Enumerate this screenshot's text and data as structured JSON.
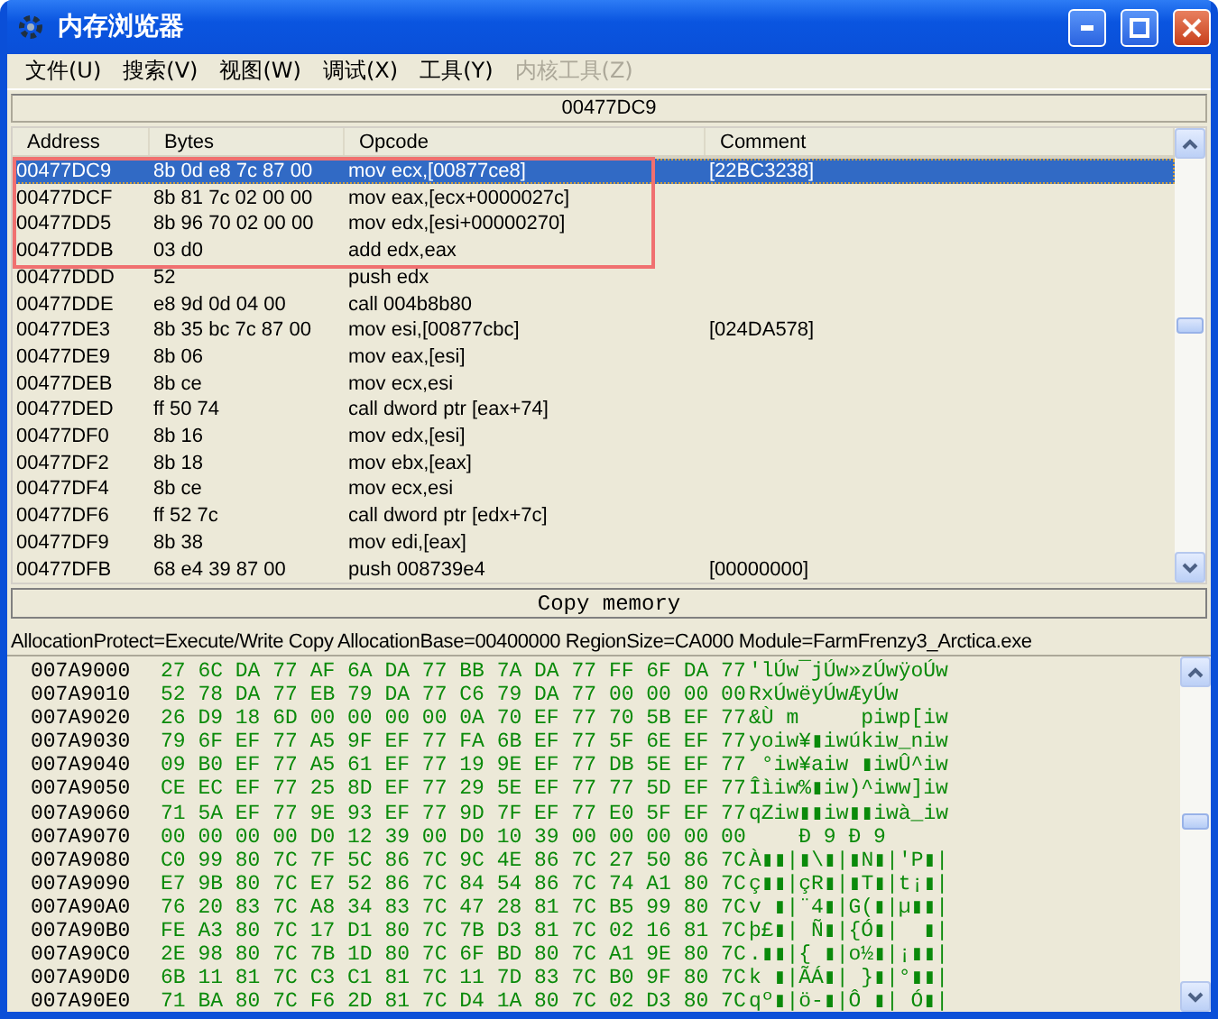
{
  "window": {
    "title": "内存浏览器"
  },
  "menu": [
    {
      "label": "文件(U)",
      "disabled": false
    },
    {
      "label": "搜索(V)",
      "disabled": false
    },
    {
      "label": "视图(W)",
      "disabled": false
    },
    {
      "label": "调试(X)",
      "disabled": false
    },
    {
      "label": "工具(Y)",
      "disabled": false
    },
    {
      "label": "内核工具(Z)",
      "disabled": true
    }
  ],
  "address_bar": "00477DC9",
  "disassembly": {
    "columns": [
      "Address",
      "Bytes",
      "Opcode",
      "Comment"
    ],
    "rows": [
      {
        "address": "00477DC9",
        "bytes": "8b 0d e8 7c 87 00",
        "opcode": "mov ecx,[00877ce8]",
        "comment": "[22BC3238]",
        "selected": true,
        "outlined": true
      },
      {
        "address": "00477DCF",
        "bytes": "8b 81 7c 02 00 00",
        "opcode": "mov eax,[ecx+0000027c]",
        "selected": false,
        "outlined": true
      },
      {
        "address": "00477DD5",
        "bytes": "8b 96 70 02 00 00",
        "opcode": "mov edx,[esi+00000270]",
        "selected": false,
        "outlined": true
      },
      {
        "address": "00477DDB",
        "bytes": "03 d0",
        "opcode": "add edx,eax",
        "selected": false,
        "outlined": true
      },
      {
        "address": "00477DDD",
        "bytes": "52",
        "opcode": "push edx",
        "selected": false,
        "outlined": false
      },
      {
        "address": "00477DDE",
        "bytes": "e8 9d 0d 04 00",
        "opcode": "call 004b8b80",
        "selected": false,
        "outlined": false
      },
      {
        "address": "00477DE3",
        "bytes": "8b 35 bc 7c 87 00",
        "opcode": "mov esi,[00877cbc]",
        "comment": "[024DA578]",
        "selected": false,
        "outlined": false
      },
      {
        "address": "00477DE9",
        "bytes": "8b 06",
        "opcode": "mov eax,[esi]",
        "selected": false,
        "outlined": false
      },
      {
        "address": "00477DEB",
        "bytes": "8b ce",
        "opcode": "mov ecx,esi",
        "selected": false,
        "outlined": false
      },
      {
        "address": "00477DED",
        "bytes": "ff 50 74",
        "opcode": "call dword ptr [eax+74]",
        "selected": false,
        "outlined": false
      },
      {
        "address": "00477DF0",
        "bytes": "8b 16",
        "opcode": "mov edx,[esi]",
        "selected": false,
        "outlined": false
      },
      {
        "address": "00477DF2",
        "bytes": "8b 18",
        "opcode": "mov ebx,[eax]",
        "selected": false,
        "outlined": false
      },
      {
        "address": "00477DF4",
        "bytes": "8b ce",
        "opcode": "mov ecx,esi",
        "selected": false,
        "outlined": false
      },
      {
        "address": "00477DF6",
        "bytes": "ff 52 7c",
        "opcode": "call dword ptr [edx+7c]",
        "selected": false,
        "outlined": false
      },
      {
        "address": "00477DF9",
        "bytes": "8b 38",
        "opcode": "mov edi,[eax]",
        "selected": false,
        "outlined": false
      },
      {
        "address": "00477DFB",
        "bytes": "68 e4 39 87 00",
        "opcode": "push 008739e4",
        "comment": "[00000000]",
        "selected": false,
        "outlined": false
      }
    ]
  },
  "copy_button": "Copy memory",
  "region_info": "AllocationProtect=Execute/Write Copy  AllocationBase=00400000 RegionSize=CA000 Module=FarmFrenzy3_Arctica.exe",
  "hex_rows": [
    {
      "address": "007A9000",
      "hex": "27 6C DA 77 AF 6A DA 77 BB 7A DA 77 FF 6F DA 77",
      "ascii": "'lÚw¯jÚw»zÚwÿoÚw"
    },
    {
      "address": "007A9010",
      "hex": "52 78 DA 77 EB 79 DA 77 C6 79 DA 77 00 00 00 00",
      "ascii": "RxÚwëyÚwÆyÚw"
    },
    {
      "address": "007A9020",
      "hex": "26 D9 18 6D 00 00 00 00 0A 70 EF 77 70 5B EF 77",
      "ascii": "&Ù m     piwp[iw"
    },
    {
      "address": "007A9030",
      "hex": "79 6F EF 77 A5 9F EF 77 FA 6B EF 77 5F 6E EF 77",
      "ascii": "yoiw¥▮iwúkiw_niw"
    },
    {
      "address": "007A9040",
      "hex": "09 B0 EF 77 A5 61 EF 77 19 9E EF 77 DB 5E EF 77",
      "ascii": " °iw¥aiw ▮iwÛ^iw"
    },
    {
      "address": "007A9050",
      "hex": "CE EC EF 77 25 8D EF 77 29 5E EF 77 77 5D EF 77",
      "ascii": "Îìiw%▮iw)^iww]iw"
    },
    {
      "address": "007A9060",
      "hex": "71 5A EF 77 9E 93 EF 77 9D 7F EF 77 E0 5F EF 77",
      "ascii": "qZiw▮▮iw▮▮iwà_iw"
    },
    {
      "address": "007A9070",
      "hex": "00 00 00 00 D0 12 39 00 D0 10 39 00 00 00 00 00",
      "ascii": "    Ð 9 Ð 9"
    },
    {
      "address": "007A9080",
      "hex": "C0 99 80 7C 7F 5C 86 7C 9C 4E 86 7C 27 50 86 7C",
      "ascii": "À▮▮|▮\\▮|▮N▮|'P▮|"
    },
    {
      "address": "007A9090",
      "hex": "E7 9B 80 7C E7 52 86 7C 84 54 86 7C 74 A1 80 7C",
      "ascii": "ç▮▮|çR▮|▮T▮|t¡▮|"
    },
    {
      "address": "007A90A0",
      "hex": "76 20 83 7C A8 34 83 7C 47 28 81 7C B5 99 80 7C",
      "ascii": "v ▮|¨4▮|G(▮|µ▮▮|"
    },
    {
      "address": "007A90B0",
      "hex": "FE A3 80 7C 17 D1 80 7C 7B D3 81 7C 02 16 81 7C",
      "ascii": "þ£▮| Ñ▮|{Ó▮|  ▮|"
    },
    {
      "address": "007A90C0",
      "hex": "2E 98 80 7C 7B 1D 80 7C 6F BD 80 7C A1 9E 80 7C",
      "ascii": ".▮▮|{ ▮|o½▮|¡▮▮|"
    },
    {
      "address": "007A90D0",
      "hex": "6B 11 81 7C C3 C1 81 7C 11 7D 83 7C B0 9F 80 7C",
      "ascii": "k ▮|ÃÁ▮| }▮|°▮▮|"
    },
    {
      "address": "007A90E0",
      "hex": "71 BA 80 7C F6 2D 81 7C D4 1A 80 7C 02 D3 80 7C",
      "ascii": "qº▮|ö-▮|Ô ▮| Ó▮|"
    }
  ]
}
